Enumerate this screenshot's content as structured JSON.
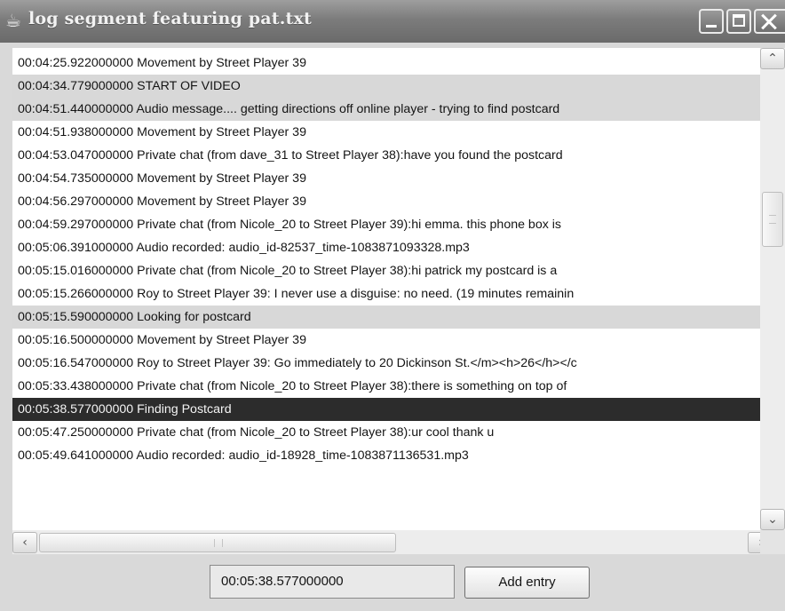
{
  "window": {
    "title": "log segment featuring pat.txt",
    "icon": "java-cup-icon"
  },
  "log": {
    "rows": [
      {
        "text": "00:04:25.922000000 Movement by Street Player 39",
        "style": "normal"
      },
      {
        "text": "00:04:34.779000000 START OF VIDEO",
        "style": "alt"
      },
      {
        "text": "00:04:51.440000000 Audio message.... getting directions off online player - trying to find postcard",
        "style": "alt"
      },
      {
        "text": "00:04:51.938000000 Movement by Street Player 39",
        "style": "normal"
      },
      {
        "text": "00:04:53.047000000 Private chat (from dave_31 to Street Player 38):have you found the postcard",
        "style": "normal"
      },
      {
        "text": "00:04:54.735000000 Movement by Street Player 39",
        "style": "normal"
      },
      {
        "text": "00:04:56.297000000 Movement by Street Player 39",
        "style": "normal"
      },
      {
        "text": "00:04:59.297000000 Private chat (from Nicole_20 to Street Player 39):hi emma.  this phone box is",
        "style": "normal"
      },
      {
        "text": "00:05:06.391000000 Audio recorded: audio_id-82537_time-1083871093328.mp3",
        "style": "normal"
      },
      {
        "text": "00:05:15.016000000 Private chat (from Nicole_20 to Street Player 38):hi patrick    my postcard is a",
        "style": "normal"
      },
      {
        "text": "00:05:15.266000000 Roy to Street Player 39: I never use a disguise: no need. (19 minutes remainin",
        "style": "normal"
      },
      {
        "text": "00:05:15.590000000 Looking for postcard",
        "style": "alt"
      },
      {
        "text": "00:05:16.500000000 Movement by Street Player 39",
        "style": "normal"
      },
      {
        "text": "00:05:16.547000000 Roy to Street Player 39: Go immediately to 20 Dickinson St.</m><h>26</h></c",
        "style": "normal"
      },
      {
        "text": "00:05:33.438000000 Private chat (from Nicole_20 to Street Player 38):there is something on top of",
        "style": "normal"
      },
      {
        "text": "00:05:38.577000000 Finding Postcard",
        "style": "selected"
      },
      {
        "text": "00:05:47.250000000 Private chat (from Nicole_20 to Street Player 38):ur cool thank u",
        "style": "normal"
      },
      {
        "text": "00:05:49.641000000 Audio recorded: audio_id-18928_time-1083871136531.mp3",
        "style": "normal"
      }
    ]
  },
  "footer": {
    "time_value": "00:05:38.577000000",
    "add_label": "Add entry"
  },
  "colors": {
    "selected_row": "#2c2c2c",
    "alt_row": "#d8d8d8",
    "titlebar": "#7c7c7c"
  }
}
